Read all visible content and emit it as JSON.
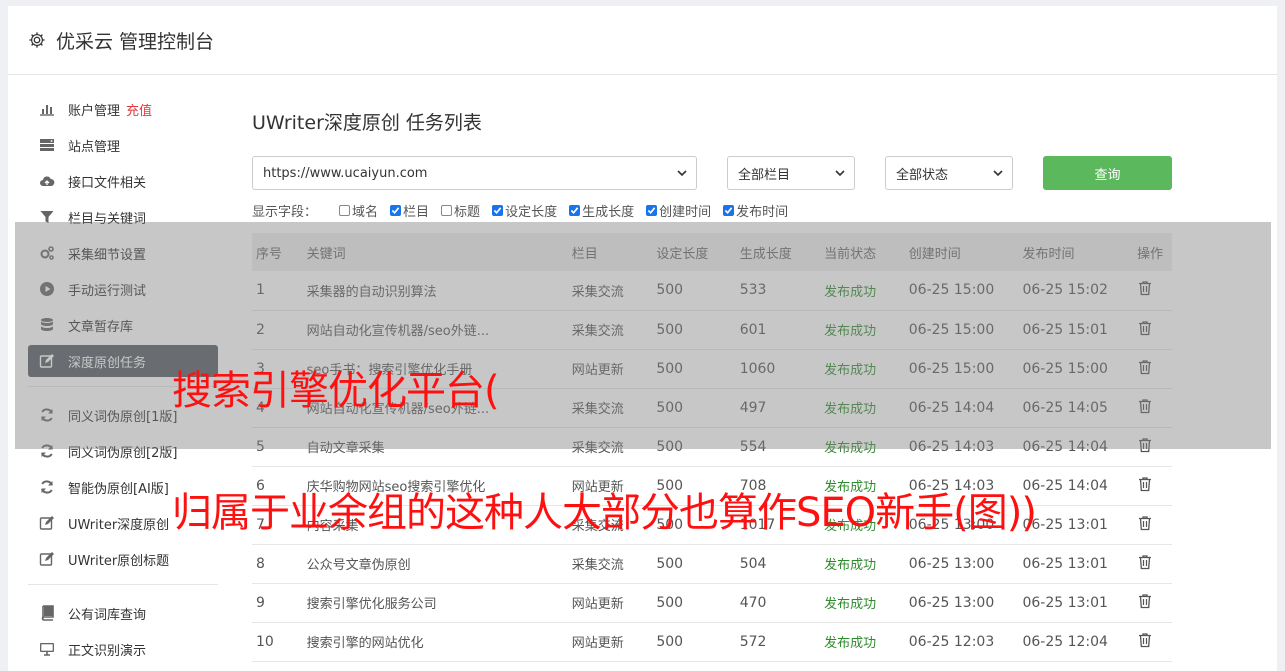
{
  "header": {
    "title": "优采云 管理控制台"
  },
  "sidebar": {
    "items": [
      {
        "label": "账户管理",
        "extra": "充值",
        "icon": "bar-chart-icon"
      },
      {
        "label": "站点管理",
        "icon": "server-icon"
      },
      {
        "label": "接口文件相关",
        "icon": "cloud-upload-icon"
      },
      {
        "label": "栏目与关键词",
        "icon": "filter-icon"
      },
      {
        "label": "采集细节设置",
        "icon": "gears-icon"
      },
      {
        "label": "手动运行测试",
        "icon": "play-circle-icon"
      },
      {
        "label": "文章暂存库",
        "icon": "database-icon"
      },
      {
        "label": "深度原创任务",
        "icon": "edit-icon"
      },
      {
        "label": "同义词伪原创[1版]",
        "icon": "refresh-icon"
      },
      {
        "label": "同义词伪原创[2版]",
        "icon": "refresh-icon"
      },
      {
        "label": "智能伪原创[AI版]",
        "icon": "refresh-icon"
      },
      {
        "label": "UWriter深度原创",
        "icon": "edit-icon"
      },
      {
        "label": "UWriter原创标题",
        "icon": "edit-icon"
      },
      {
        "label": "公有词库查询",
        "icon": "book-icon"
      },
      {
        "label": "正文识别演示",
        "icon": "monitor-icon"
      }
    ]
  },
  "main": {
    "title": "UWriter深度原创 任务列表",
    "filters": {
      "site": "https://www.ucaiyun.com",
      "column": "全部栏目",
      "status": "全部状态",
      "query_label": "查询"
    },
    "fields_label": "显示字段：",
    "fields": [
      {
        "label": "域名",
        "checked": false
      },
      {
        "label": "栏目",
        "checked": true
      },
      {
        "label": "标题",
        "checked": false
      },
      {
        "label": "设定长度",
        "checked": true
      },
      {
        "label": "生成长度",
        "checked": true
      },
      {
        "label": "创建时间",
        "checked": true
      },
      {
        "label": "发布时间",
        "checked": true
      }
    ],
    "table": {
      "headers": [
        "序号",
        "关键词",
        "栏目",
        "设定长度",
        "生成长度",
        "当前状态",
        "创建时间",
        "发布时间",
        "操作"
      ],
      "rows": [
        [
          "1",
          "采集器的自动识别算法",
          "采集交流",
          "500",
          "533",
          "发布成功",
          "06-25 15:00",
          "06-25 15:02"
        ],
        [
          "2",
          "网站自动化宣传机器/seo外链...",
          "采集交流",
          "500",
          "601",
          "发布成功",
          "06-25 15:00",
          "06-25 15:01"
        ],
        [
          "3",
          "seo手书：搜索引擎优化手册",
          "网站更新",
          "500",
          "1060",
          "发布成功",
          "06-25 15:00",
          "06-25 15:00"
        ],
        [
          "4",
          "网站自动化宣传机器/seo外链...",
          "采集交流",
          "500",
          "497",
          "发布成功",
          "06-25 14:04",
          "06-25 14:05"
        ],
        [
          "5",
          "自动文章采集",
          "采集交流",
          "500",
          "554",
          "发布成功",
          "06-25 14:03",
          "06-25 14:04"
        ],
        [
          "6",
          "庆华购物网站seo搜索引擎优化",
          "网站更新",
          "500",
          "708",
          "发布成功",
          "06-25 14:03",
          "06-25 14:04"
        ],
        [
          "7",
          "内容采集",
          "采集交流",
          "500",
          "1017",
          "发布成功",
          "06-25 13:00",
          "06-25 13:01"
        ],
        [
          "8",
          "公众号文章伪原创",
          "采集交流",
          "500",
          "504",
          "发布成功",
          "06-25 13:00",
          "06-25 13:01"
        ],
        [
          "9",
          "搜索引擎优化服务公司",
          "网站更新",
          "500",
          "470",
          "发布成功",
          "06-25 13:00",
          "06-25 13:01"
        ],
        [
          "10",
          "搜索引擎的网站优化",
          "网站更新",
          "500",
          "572",
          "发布成功",
          "06-25 12:03",
          "06-25 12:04"
        ]
      ]
    }
  },
  "overlay": {
    "line1": "搜索引擎优化平台(",
    "line2": "归属于业余组的这种人大部分也算作SEO新手(图))"
  },
  "colors": {
    "accent_green": "#5cb85c",
    "status_green": "#2e8b2e",
    "overlay_red": "#ff1010",
    "active_nav": "#555a61"
  }
}
